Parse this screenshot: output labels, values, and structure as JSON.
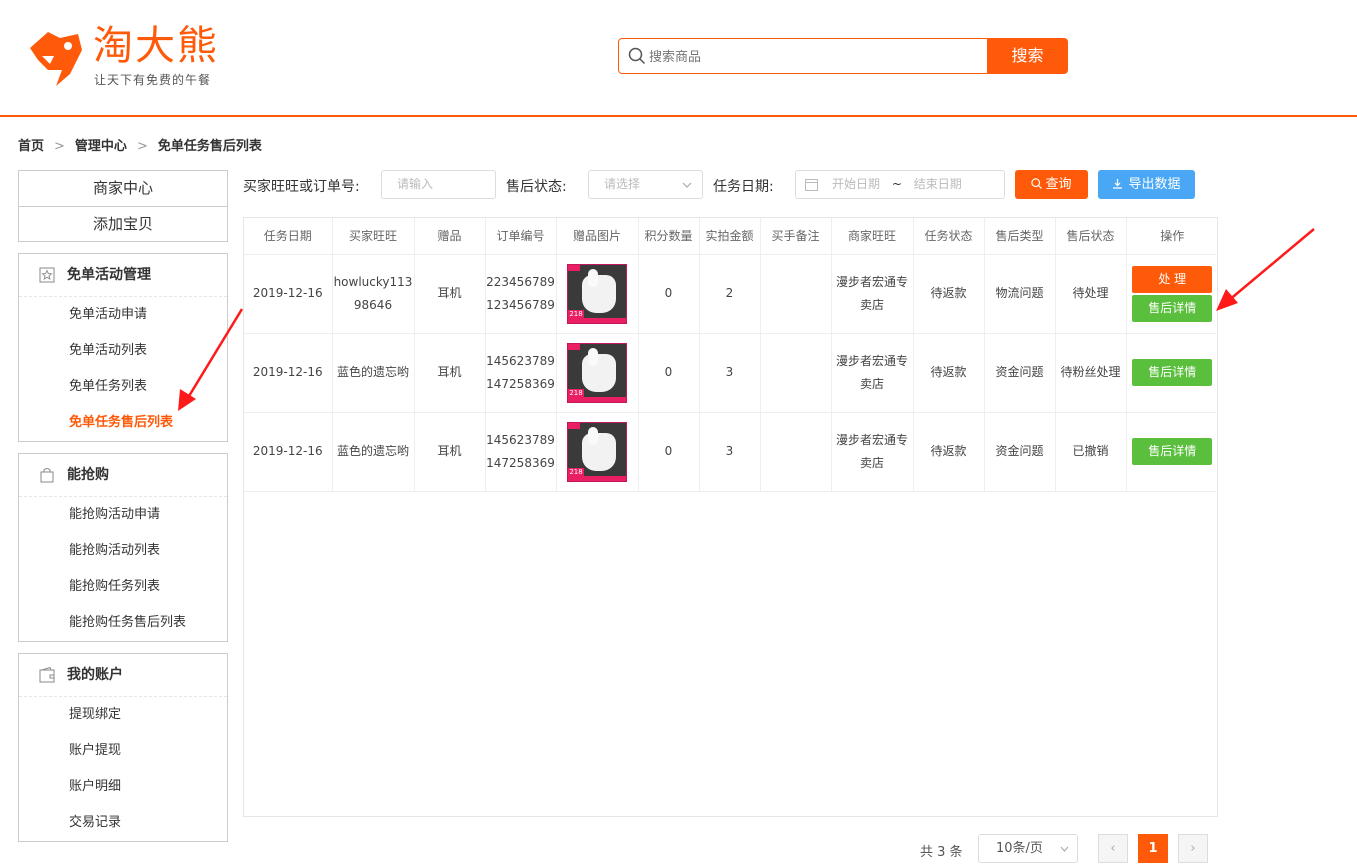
{
  "brand": {
    "name": "淘大熊",
    "slogan": "让天下有免费的午餐",
    "accent": "#ff5a0a"
  },
  "search": {
    "placeholder": "搜索商品",
    "button": "搜索"
  },
  "breadcrumb": [
    "首页",
    "管理中心",
    "免单任务售后列表"
  ],
  "sidebar": {
    "top": [
      "商家中心",
      "添加宝贝"
    ],
    "groups": [
      {
        "title": "免单活动管理",
        "icon": "star-icon",
        "items": [
          "免单活动申请",
          "免单活动列表",
          "免单任务列表",
          "免单任务售后列表"
        ],
        "active": 3
      },
      {
        "title": "能抢购",
        "icon": "bag-icon",
        "items": [
          "能抢购活动申请",
          "能抢购活动列表",
          "能抢购任务列表",
          "能抢购任务售后列表"
        ]
      },
      {
        "title": "我的账户",
        "icon": "wallet-icon",
        "items": [
          "提现绑定",
          "账户提现",
          "账户明细",
          "交易记录"
        ]
      }
    ]
  },
  "filter": {
    "buyer_label": "买家旺旺或订单号:",
    "buyer_placeholder": "请输入",
    "status_label": "售后状态:",
    "status_placeholder": "请选择",
    "date_label": "任务日期:",
    "date_start": "开始日期",
    "date_sep": "~",
    "date_end": "结束日期",
    "query": "查询",
    "export": "导出数据"
  },
  "table": {
    "headers": [
      "任务日期",
      "买家旺旺",
      "赠品",
      "订单编号",
      "赠品图片",
      "积分数量",
      "实拍金额",
      "买手备注",
      "商家旺旺",
      "任务状态",
      "售后类型",
      "售后状态",
      "操作"
    ],
    "rows": [
      {
        "date": "2019-12-16",
        "buyer": "howlucky11398646",
        "gift": "耳机",
        "orders": [
          "223456789",
          "123456789"
        ],
        "img_price": "218",
        "points": "0",
        "amount": "2",
        "note": "",
        "merchant": "漫步者宏通专卖店",
        "task_status": "待返款",
        "type": "物流问题",
        "status": "待处理",
        "ops": [
          "处 理",
          "售后详情"
        ]
      },
      {
        "date": "2019-12-16",
        "buyer": "蓝色的遗忘哟",
        "gift": "耳机",
        "orders": [
          "145623789",
          "147258369"
        ],
        "img_price": "218",
        "points": "0",
        "amount": "3",
        "note": "",
        "merchant": "漫步者宏通专卖店",
        "task_status": "待返款",
        "type": "资金问题",
        "status": "待粉丝处理",
        "ops": [
          "售后详情"
        ]
      },
      {
        "date": "2019-12-16",
        "buyer": "蓝色的遗忘哟",
        "gift": "耳机",
        "orders": [
          "145623789",
          "147258369"
        ],
        "img_price": "218",
        "points": "0",
        "amount": "3",
        "note": "",
        "merchant": "漫步者宏通专卖店",
        "task_status": "待返款",
        "type": "资金问题",
        "status": "已撤销",
        "ops": [
          "售后详情"
        ]
      }
    ]
  },
  "pager": {
    "total": "共 3 条",
    "size": "10条/页",
    "current": "1",
    "prev": "‹",
    "next": "›"
  }
}
